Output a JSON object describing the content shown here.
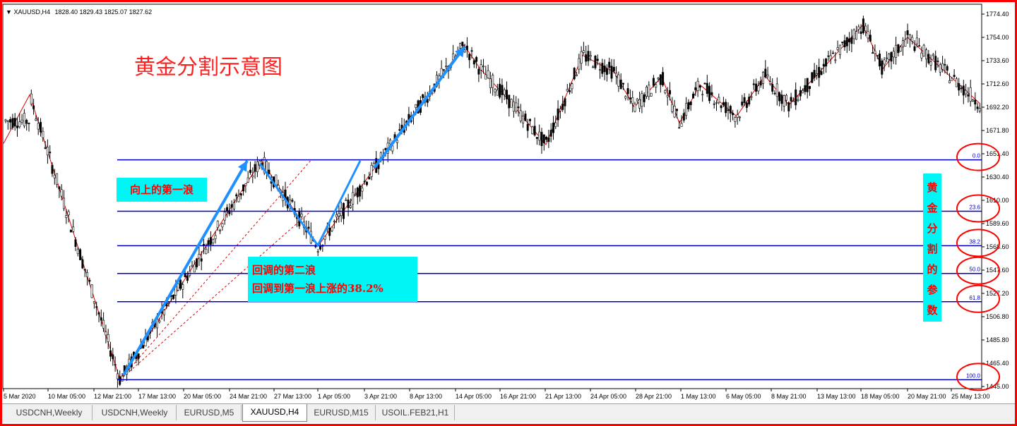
{
  "header": {
    "symbol": "XAUUSD,H4",
    "ohlc": "1828.40 1829.43 1825.07 1827.62"
  },
  "overlay_title": "黄金分割示意图",
  "annotations": {
    "first_wave": "向上的第一浪",
    "second_wave_line1": "回调的第二浪",
    "second_wave_line2": "回调到第一浪上涨的38.2%",
    "fib_vertical": [
      "黄",
      "金",
      "分",
      "割",
      "的",
      "参",
      "数"
    ]
  },
  "fib_levels": [
    {
      "label": "0.0",
      "price": 1645.5
    },
    {
      "label": "23.6",
      "price": 1600.0
    },
    {
      "label": "38.2",
      "price": 1569.5
    },
    {
      "label": "50.0",
      "price": 1545.0
    },
    {
      "label": "61.8",
      "price": 1520.0
    },
    {
      "label": "100.0",
      "price": 1451.0
    }
  ],
  "price_axis": [
    "1774.40",
    "1754.00",
    "1733.60",
    "1712.60",
    "1692.20",
    "1671.80",
    "1651.40",
    "1630.40",
    "1610.00",
    "1589.60",
    "1568.60",
    "1547.60",
    "1527.20",
    "1506.80",
    "1485.80",
    "1465.40",
    "1445.00"
  ],
  "time_axis": [
    "5 Mar 2020",
    "10 Mar 05:00",
    "12 Mar 21:00",
    "17 Mar 13:00",
    "20 Mar 05:00",
    "24 Mar 21:00",
    "27 Mar 13:00",
    "1 Apr 05:00",
    "3 Apr 21:00",
    "8 Apr 13:00",
    "14 Apr 05:00",
    "16 Apr 21:00",
    "21 Apr 13:00",
    "24 Apr 05:00",
    "28 Apr 21:00",
    "1 May 13:00",
    "6 May 05:00",
    "8 May 21:00",
    "13 May 13:00",
    "18 May 05:00",
    "20 May 21:00",
    "25 May 13:00"
  ],
  "tabs": [
    {
      "label": "USDCNH,Weekly",
      "active": false
    },
    {
      "label": "USDCNH,Weekly",
      "active": false
    },
    {
      "label": "EURUSD,M5",
      "active": false
    },
    {
      "label": "XAUUSD,H4",
      "active": true
    },
    {
      "label": "EURUSD,M15",
      "active": false
    },
    {
      "label": "USOIL.FEB21,H1",
      "active": false
    }
  ],
  "colors": {
    "fib_line": "#0000cc",
    "zigzag": "#dd0000",
    "arrow": "#1e90ff",
    "candle": "#000000",
    "highlight_box": "#00f5f5",
    "annotation_text": "#ff0000",
    "circle": "#ff0000"
  },
  "chart_data": {
    "type": "candlestick",
    "symbol": "XAUUSD",
    "timeframe": "H4",
    "ylim": [
      1445.0,
      1774.4
    ],
    "zigzag_pivots": [
      {
        "t": "5 Mar 2020",
        "price": 1703
      },
      {
        "t": "16 Mar",
        "price": 1451
      },
      {
        "t": "25 Mar",
        "price": 1645
      },
      {
        "t": "31 Mar",
        "price": 1569
      },
      {
        "t": "14 Apr",
        "price": 1747
      },
      {
        "t": "17 Apr",
        "price": 1712
      },
      {
        "t": "21 Apr",
        "price": 1659
      },
      {
        "t": "23 Apr",
        "price": 1738
      },
      {
        "t": "27 Apr",
        "price": 1715
      },
      {
        "t": "29 Apr",
        "price": 1692
      },
      {
        "t": "30 Apr",
        "price": 1719
      },
      {
        "t": "1 May",
        "price": 1678
      },
      {
        "t": "4 May",
        "price": 1712
      },
      {
        "t": "6 May",
        "price": 1684
      },
      {
        "t": "8 May",
        "price": 1720
      },
      {
        "t": "11 May",
        "price": 1694
      },
      {
        "t": "18 May",
        "price": 1765
      },
      {
        "t": "19 May",
        "price": 1726
      },
      {
        "t": "21 May",
        "price": 1754
      },
      {
        "t": "26 May",
        "price": 1695
      }
    ]
  }
}
